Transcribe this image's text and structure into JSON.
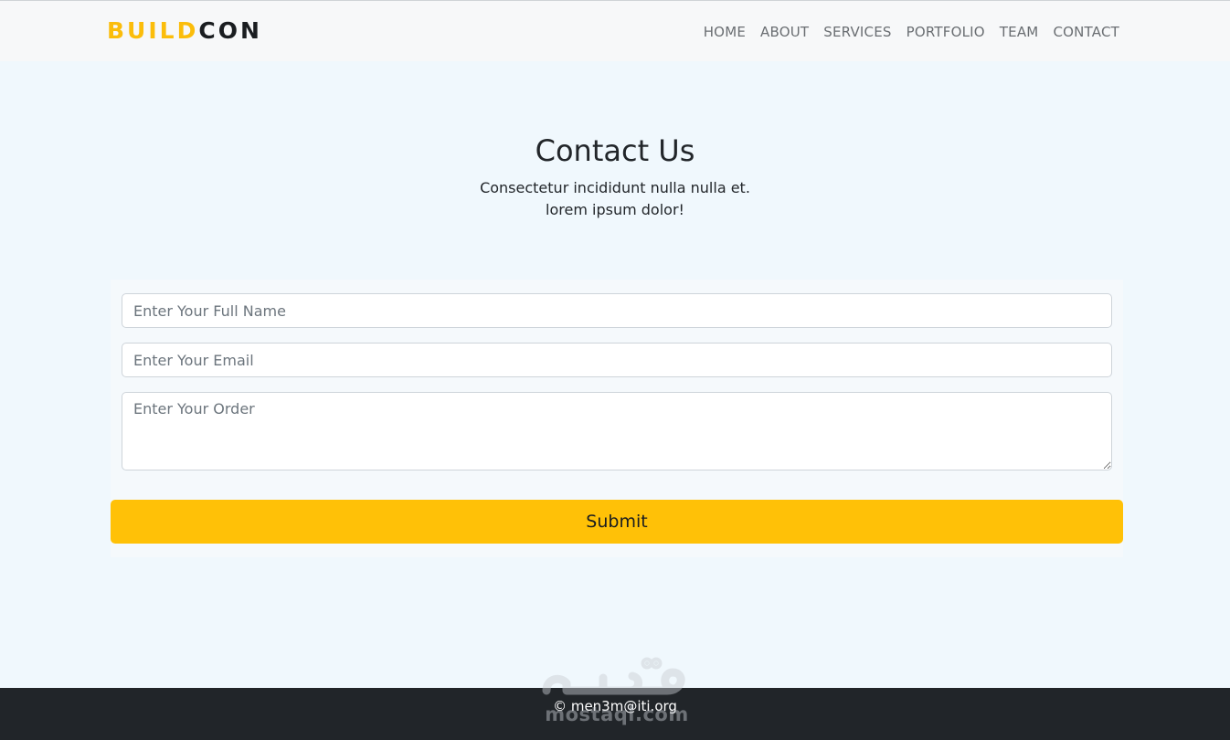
{
  "navbar": {
    "brand_part1": "BUILD",
    "brand_part2": "CON",
    "links": [
      "HOME",
      "ABOUT",
      "SERVICES",
      "PORTFOLIO",
      "TEAM",
      "CONTACT"
    ],
    "brand_accent_color": "#fbbd0b"
  },
  "main": {
    "title": "Contact Us",
    "subtitle_line1": "Consectetur incididunt nulla nulla et.",
    "subtitle_line2": "lorem ipsum dolor!"
  },
  "form": {
    "name_placeholder": "Enter Your Full Name",
    "email_placeholder": "Enter Your Email",
    "order_placeholder": "Enter Your Order",
    "submit_label": "Submit",
    "submit_color": "#ffc107"
  },
  "footer": {
    "text": "© men3m@iti.org"
  },
  "watermark": {
    "latin": "mostaql.com"
  }
}
